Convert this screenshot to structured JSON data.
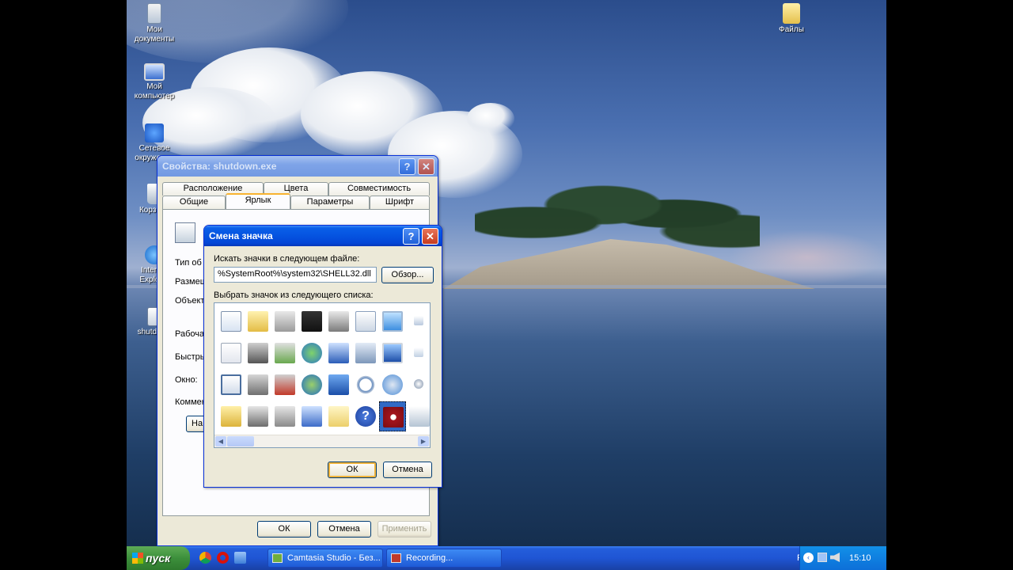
{
  "desktop": {
    "icons": [
      {
        "label": "Мои документы",
        "icon": "my-documents-icon"
      },
      {
        "label": "Мой компьютер",
        "icon": "my-computer-icon"
      },
      {
        "label": "Сетевое окружение",
        "icon": "network-icon"
      },
      {
        "label": "Корзина",
        "icon": "recycle-bin-icon"
      },
      {
        "label": "Internet Explorer",
        "icon": "ie-icon"
      },
      {
        "label": "shutdown",
        "icon": "shutdown-shortcut-icon"
      },
      {
        "label": "Файлы",
        "icon": "folder-icon"
      }
    ]
  },
  "properties_window": {
    "title": "Свойства: shutdown.exe",
    "tabs_row1": [
      "Расположение",
      "Цвета",
      "Совместимость"
    ],
    "tabs_row2": [
      "Общие",
      "Ярлык",
      "Параметры",
      "Шрифт"
    ],
    "active_tab": "Ярлык",
    "field_labels": [
      "Тип об",
      "Размещ",
      "Объект",
      "Рабочая",
      "Быстры",
      "Окно:",
      "Коммен",
      "На"
    ],
    "ok_label": "ОК",
    "cancel_label": "Отмена",
    "apply_label": "Применить"
  },
  "change_icon_dialog": {
    "title": "Смена значка",
    "search_label": "Искать значки в следующем файле:",
    "file_path": "%SystemRoot%\\system32\\SHELL32.dll",
    "browse_label": "Обзор...",
    "select_label": "Выбрать значок из следующего списка:",
    "icons": [
      "windows-file-icon",
      "folder-icon",
      "drive-icon",
      "memory-chip-icon",
      "printer-icon",
      "scheduled-icon",
      "display-icon",
      "small-window-icon",
      "document-icon",
      "drive-lock-icon",
      "network-drive-icon",
      "globe-net-icon",
      "network-pc-icon",
      "pc-icon",
      "monitor-icon",
      "shortcut-small-icon",
      "window-app-icon",
      "floppy-drive-icon",
      "disconnected-drive-icon",
      "internet-globe-icon",
      "windows-network-icon",
      "search-icon",
      "cd-drive-icon",
      "clock-small-icon",
      "open-folder-icon",
      "hard-drive-icon",
      "network-drive2-icon",
      "computer-icon",
      "folder-blank-icon",
      "help-icon",
      "shutdown-icon",
      "recycle-bin-icon"
    ],
    "selected_icon": "shutdown-icon",
    "ok_label": "ОК",
    "cancel_label": "Отмена"
  },
  "taskbar": {
    "start_label": "пуск",
    "items": [
      {
        "label": "Camtasia Studio - Без...",
        "icon": "camtasia-icon"
      },
      {
        "label": "Recording...",
        "icon": "recording-icon"
      }
    ],
    "language": "RL",
    "time": "15:10"
  }
}
